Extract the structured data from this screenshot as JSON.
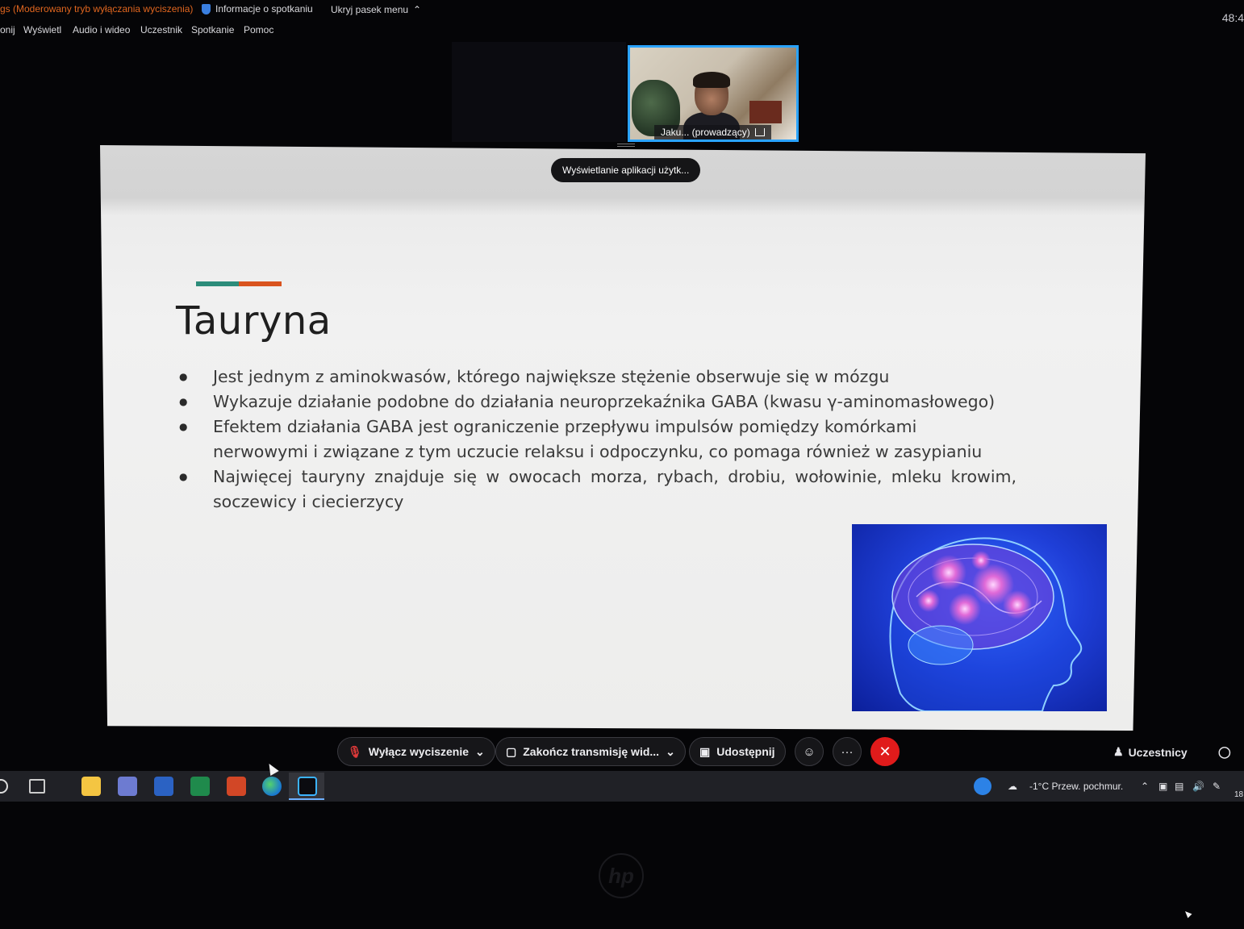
{
  "app": {
    "mode_text": "gs (Moderowany tryb wyłączania wyciszenia)",
    "meeting_info_label": "Informacje o spotkaniu",
    "hide_menu_label": "Ukryj pasek menu",
    "clock": "48:4"
  },
  "menu": {
    "items": [
      "onij",
      "Wyświetl",
      "Audio i wideo",
      "Uczestnik",
      "Spotkanie",
      "Pomoc"
    ]
  },
  "video": {
    "participant_label": "Jaku... (prowadzący)"
  },
  "toast": "Wyświetlanie aplikacji użytk...",
  "slide": {
    "title": "Tauryna",
    "bullets": [
      "Jest jednym z aminokwasów, którego największe stężenie obserwuje się w mózgu",
      "Wykazuje działanie podobne do działania neuroprzekaźnika GABA (kwasu γ-aminomasłowego)",
      "Efektem działania GABA jest ograniczenie przepływu impulsów pomiędzy komórkami nerwowymi i związane z tym uczucie relaksu i odpoczynku, co pomaga również w zasypianiu",
      "Najwięcej tauryny znajduje się w owocach morza, rybach, drobiu, wołowinie, mleku krowim, soczewicy i ciecierzycy"
    ],
    "accent_colors": [
      "#2c8c7a",
      "#d9531e"
    ]
  },
  "controls": {
    "unmute_label": "Wyłącz wyciszenie",
    "stop_video_label": "Zakończ transmisję wid...",
    "share_label": "Udostępnij",
    "more_label": "···",
    "end_label": "✕",
    "participants_label": "Uczestnicy",
    "end_color": "#e01b1b"
  },
  "taskbar": {
    "weather": "-1°C  Przew. pochmur.",
    "tray_date": "18"
  }
}
